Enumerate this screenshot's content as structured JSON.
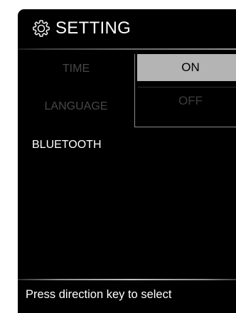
{
  "header": {
    "icon": "gear-icon",
    "title": "SETTING"
  },
  "menu": {
    "items": [
      {
        "label": "TIME",
        "state": "dimmed"
      },
      {
        "label": "LANGUAGE",
        "state": "dimmed"
      },
      {
        "label": "BLUETOOTH",
        "state": "selected"
      }
    ]
  },
  "submenu": {
    "options": [
      {
        "label": "ON",
        "state": "highlighted"
      },
      {
        "label": "OFF",
        "state": "dimmed"
      }
    ]
  },
  "footer": {
    "hint": "Press direction key to select"
  },
  "colors": {
    "background": "#000000",
    "text": "#ffffff",
    "dimmed_text": "#474747",
    "highlight_bg": "#b4b4b4"
  }
}
